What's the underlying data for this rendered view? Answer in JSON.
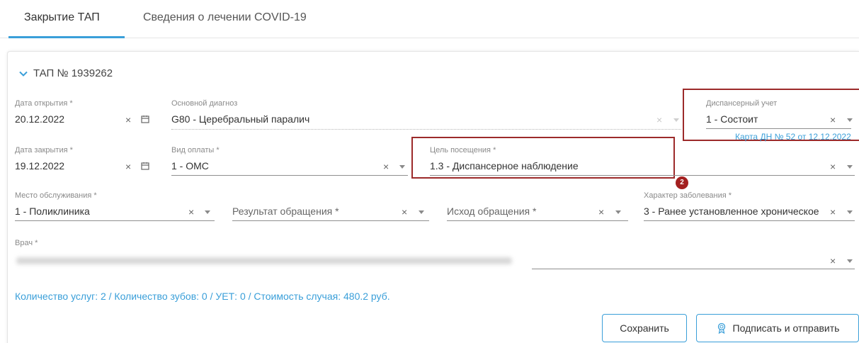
{
  "tabs": [
    {
      "label": "Закрытие ТАП",
      "active": true
    },
    {
      "label": "Сведения о лечении COVID-19",
      "active": false
    }
  ],
  "card": {
    "title": "ТАП № 1939262"
  },
  "fields": {
    "open_date": {
      "label": "Дата открытия *",
      "value": "20.12.2022"
    },
    "main_diagnosis": {
      "label": "Основной диагноз",
      "value": "G80 - Церебральный паралич"
    },
    "dispensary": {
      "label": "Диспансерный учет",
      "value": "1 - Состоит",
      "link": "Карта ДН № 52 от 12.12.2022"
    },
    "close_date": {
      "label": "Дата закрытия *",
      "value": "19.12.2022"
    },
    "payment_type": {
      "label": "Вид оплаты *",
      "value": "1 - ОМС"
    },
    "visit_purpose": {
      "label": "Цель посещения *",
      "value": "1.3 - Диспансерное наблюдение"
    },
    "service_place": {
      "label": "Место обслуживания *",
      "value": "1 - Поликлиника"
    },
    "request_result": {
      "placeholder": "Результат обращения *"
    },
    "request_outcome": {
      "placeholder": "Исход обращения *"
    },
    "disease_character": {
      "label": "Характер заболевания *",
      "value": "3 - Ранее установленное хроническое"
    },
    "doctor": {
      "label": "Врач *"
    }
  },
  "badges": {
    "two": "2"
  },
  "summary": "Количество услуг: 2 / Количество зубов: 0 / УЕТ: 0 / Стоимость случая: 480.2 руб.",
  "buttons": {
    "save": "Сохранить",
    "sign_send": "Подписать и отправить"
  },
  "icons": {
    "clear": "×",
    "chevron": "chevron-down-icon",
    "calendar": "calendar-icon",
    "certificate": "certificate-icon"
  },
  "colors": {
    "accent": "#3a9fd9",
    "highlight": "#9c2a2a",
    "badge": "#a31f1f"
  }
}
